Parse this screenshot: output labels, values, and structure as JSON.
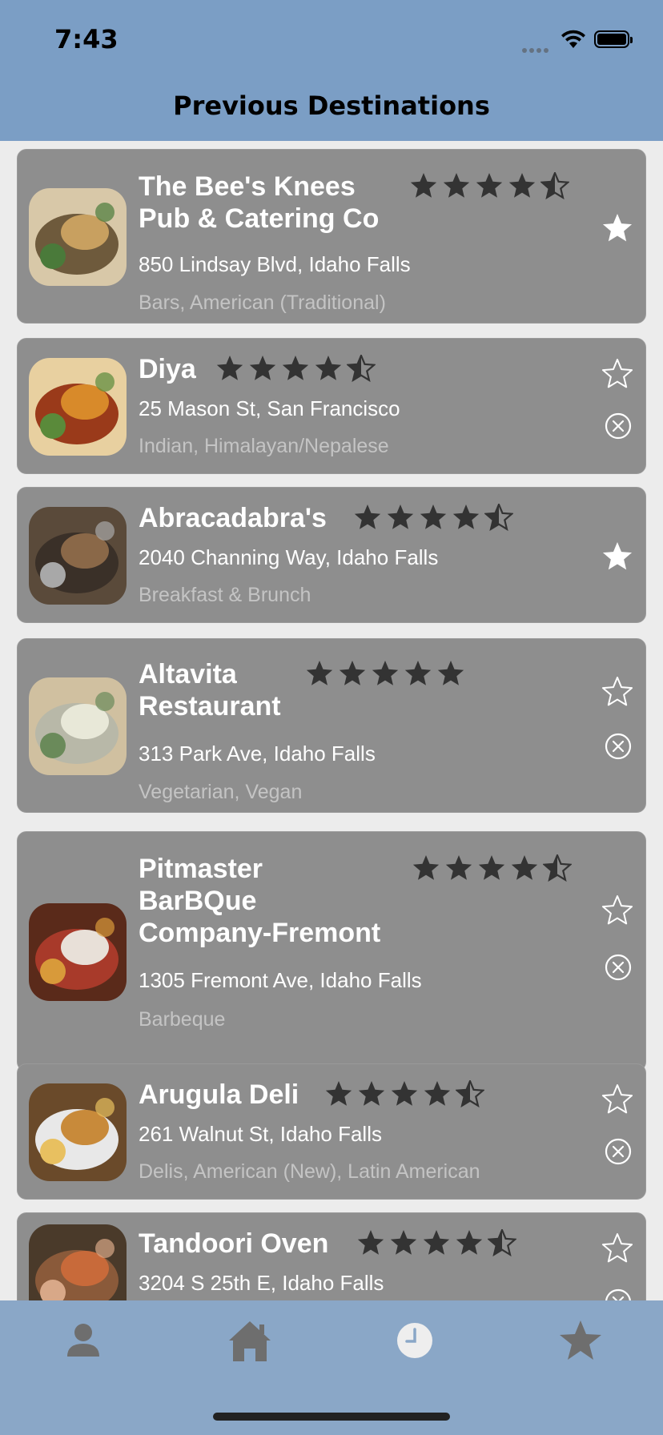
{
  "status_bar": {
    "time": "7:43"
  },
  "header": {
    "title": "Previous Destinations"
  },
  "icons": {
    "star_filled": "star-filled-icon",
    "star_half": "star-half-icon",
    "favorite": "star-icon",
    "remove": "close-circle-icon"
  },
  "colors": {
    "bar_blue": "#7b9ec5",
    "tab_blue": "#8aa7c7",
    "card_gray": "#8e8e8e",
    "star_dark": "#333333"
  },
  "restaurants": [
    {
      "name_lines": [
        "The Bee's Knees",
        "Pub & Catering Co"
      ],
      "rating": 4.5,
      "address": "850 Lindsay Blvd, Idaho Falls",
      "category": "Bars, American (Traditional)",
      "favorite": true,
      "removable": false
    },
    {
      "name_lines": [
        "Diya"
      ],
      "rating": 4.5,
      "address": "25 Mason St, San Francisco",
      "category": "Indian, Himalayan/Nepalese",
      "favorite": false,
      "removable": true
    },
    {
      "name_lines": [
        "Abracadabra's"
      ],
      "rating": 4.5,
      "address": "2040 Channing Way, Idaho Falls",
      "category": "Breakfast & Brunch",
      "favorite": true,
      "removable": false
    },
    {
      "name_lines": [
        "Altavita",
        "Restaurant"
      ],
      "rating": 5,
      "address": "313 Park Ave, Idaho Falls",
      "category": "Vegetarian, Vegan",
      "favorite": false,
      "removable": true
    },
    {
      "name_lines": [
        "Pitmaster",
        "BarBQue",
        "Company-Fremont"
      ],
      "rating": 4.5,
      "address": "1305 Fremont Ave, Idaho Falls",
      "category": "Barbeque",
      "favorite": false,
      "removable": true
    },
    {
      "name_lines": [
        "Arugula Deli"
      ],
      "rating": 4.5,
      "address": "261 Walnut St, Idaho Falls",
      "category": "Delis, American (New), Latin American",
      "favorite": false,
      "removable": true
    },
    {
      "name_lines": [
        "Tandoori Oven"
      ],
      "rating": 4.5,
      "address": "3204 S 25th E, Idaho Falls",
      "category": "",
      "favorite": false,
      "removable": true
    }
  ],
  "tab_bar": {
    "tabs": [
      {
        "icon": "person-icon",
        "selected": false
      },
      {
        "icon": "house-icon",
        "selected": false
      },
      {
        "icon": "clock-icon",
        "selected": true
      },
      {
        "icon": "star-icon",
        "selected": false
      }
    ]
  }
}
